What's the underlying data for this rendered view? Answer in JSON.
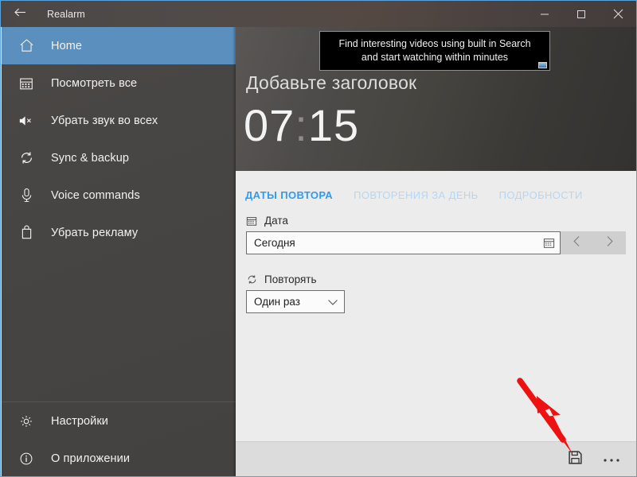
{
  "window": {
    "title": "Realarm",
    "back_icon": "back-arrow-icon",
    "minimize_label": "─",
    "maximize_label": "☐",
    "close_label": "✕"
  },
  "toast": {
    "line1": "Find interesting videos using built in Search",
    "line2": "and start watching within minutes"
  },
  "sidebar": {
    "items": [
      {
        "label": "Home",
        "icon": "home-icon",
        "selected": true
      },
      {
        "label": "Посмотреть все",
        "icon": "calendar-icon",
        "selected": false
      },
      {
        "label": "Убрать звук во всех",
        "icon": "mute-icon",
        "selected": false
      },
      {
        "label": "Sync & backup",
        "icon": "sync-icon",
        "selected": false
      },
      {
        "label": "Voice commands",
        "icon": "microphone-icon",
        "selected": false
      },
      {
        "label": "Убрать рекламу",
        "icon": "shopping-bag-icon",
        "selected": false
      }
    ],
    "bottom_items": [
      {
        "label": "Настройки",
        "icon": "gear-icon"
      },
      {
        "label": "О приложении",
        "icon": "info-icon"
      }
    ]
  },
  "hero": {
    "title": "Добавьте заголовок",
    "hours": "07",
    "colon": ":",
    "minutes": "15"
  },
  "tabs": [
    {
      "label": "ДАТЫ ПОВТОРА",
      "active": true
    },
    {
      "label": "ПОВТОРЕНИЯ ЗА ДЕНЬ",
      "active": false
    },
    {
      "label": "ПОДРОБНОСТИ",
      "active": false
    }
  ],
  "form": {
    "date_label": "Дата",
    "date_value": "Сегодня",
    "date_icon": "calendar-icon",
    "prev_icon": "chevron-left-icon",
    "next_icon": "chevron-right-icon",
    "repeat_label": "Повторять",
    "repeat_value": "Один раз",
    "repeat_icon": "repeat-icon"
  },
  "commandbar": {
    "save_icon": "save-floppy-icon",
    "more_icon": "ellipsis-icon"
  },
  "annotation": {
    "arrow_color": "#ee1111",
    "points_to": "save-button"
  },
  "colors": {
    "accent_tab": "#2e9bf0",
    "sidebar_selected": "#5b8fbe",
    "window_border": "#5ea0d8",
    "pane_background": "#ececec"
  }
}
